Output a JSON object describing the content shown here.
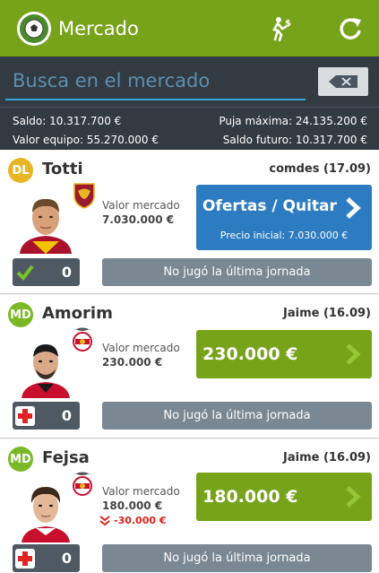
{
  "header": {
    "title": "Mercado",
    "logo_icon": "soccer-ball-logo-icon",
    "actions": [
      "player-money-icon",
      "refresh-icon"
    ],
    "color": "#76a31a"
  },
  "search": {
    "placeholder": "Busca en el mercado",
    "value": ""
  },
  "summary": {
    "saldo": "Saldo: 10.317.700 €",
    "puja_maxima": "Puja máxima: 24.135.200 €",
    "valor_equipo": "Valor equipo: 55.270.000 €",
    "saldo_futuro": "Saldo futuro: 10.317.700 €"
  },
  "players": [
    {
      "position": "DL",
      "name": "Totti",
      "owner": "comdes (17.09)",
      "market_label": "Valor mercado",
      "market_value": "7.030.000 €",
      "button_title": "Ofertas / Quitar",
      "button_sub": "Precio inicial: 7.030.000 €",
      "status_icon": "check-icon",
      "status_count": "0",
      "jornada": "No jugó la última jornada",
      "club_icon": "roma-crest-icon"
    },
    {
      "position": "MD",
      "name": "Amorim",
      "owner": "Jaime (16.09)",
      "market_label": "Valor mercado",
      "market_value": "230.000 €",
      "price": "230.000 €",
      "status_icon": "medical-cross-icon",
      "status_count": "0",
      "jornada": "No jugó la última jornada",
      "club_icon": "benfica-crest-icon"
    },
    {
      "position": "MD",
      "name": "Fejsa",
      "owner": "Jaime (16.09)",
      "market_label": "Valor mercado",
      "market_value": "180.000 €",
      "delta": "-30.000 €",
      "price": "180.000 €",
      "status_icon": "medical-cross-icon",
      "status_count": "0",
      "jornada": "No jugó la última jornada",
      "club_icon": "benfica-crest-icon"
    }
  ]
}
